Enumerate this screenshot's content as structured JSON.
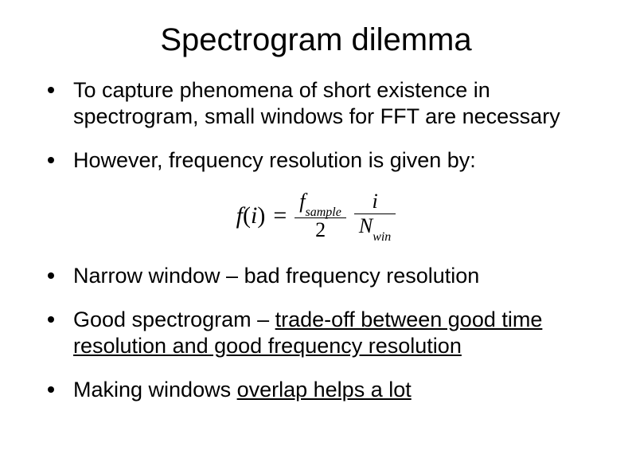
{
  "title": "Spectrogram dilemma",
  "bullets": {
    "b1": "To capture phenomena of short existence in spectrogram, small windows for FFT are necessary",
    "b2": "However, frequency resolution is given by:",
    "b3": "Narrow window – bad frequency resolution",
    "b4_prefix": "Good spectrogram – ",
    "b4_underlined": "trade-off between good time resolution and good frequency resolution",
    "b5_prefix": "Making windows ",
    "b5_underlined": "overlap helps a lot"
  },
  "formula": {
    "lhs_fn": "f",
    "lhs_arg": "i",
    "eq": "=",
    "frac1_num_var": "f",
    "frac1_num_sub": "sample",
    "frac1_den": "2",
    "frac2_num": "i",
    "frac2_den_var": "N",
    "frac2_den_sub": "win"
  }
}
